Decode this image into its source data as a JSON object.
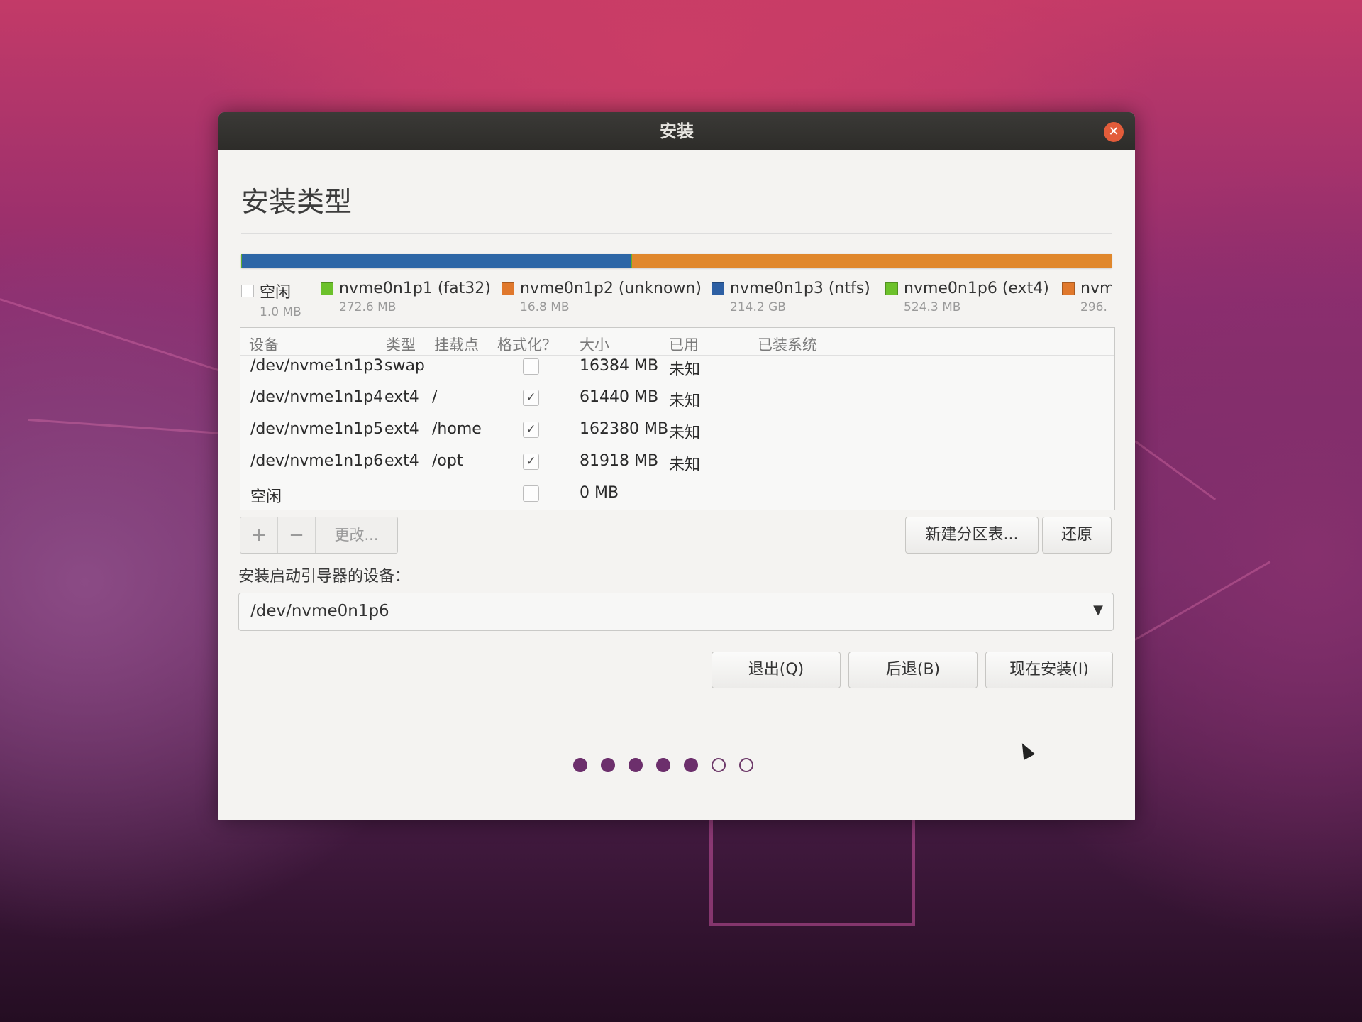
{
  "window": {
    "title": "安装",
    "close_icon": "close-icon"
  },
  "page": {
    "heading": "安装类型"
  },
  "partition_bar": {
    "segments": [
      {
        "name": "空闲",
        "color": "#ffffff",
        "fraction": 0.0002
      },
      {
        "name": "nvme0n1p1",
        "color": "#5fae2c",
        "fraction": 0.0006
      },
      {
        "name": "nvme0n1p2",
        "color": "#e0782c",
        "fraction": 0.0001
      },
      {
        "name": "nvme0n1p3",
        "color": "#2d66a6",
        "fraction": 0.447
      },
      {
        "name": "nvme0n1p6",
        "color": "#5fae2c",
        "fraction": 0.001
      },
      {
        "name": "nvm",
        "color": "#e0872c",
        "fraction": 0.5511
      }
    ]
  },
  "legend": [
    {
      "name": "空闲",
      "size": "1.0 MB",
      "color": "#ffffff"
    },
    {
      "name": "nvme0n1p1 (fat32)",
      "size": "272.6 MB",
      "color": "#6cc12b"
    },
    {
      "name": "nvme0n1p2 (unknown)",
      "size": "16.8 MB",
      "color": "#e0782c"
    },
    {
      "name": "nvme0n1p3 (ntfs)",
      "size": "214.2 GB",
      "color": "#2d5fa3"
    },
    {
      "name": "nvme0n1p6 (ext4)",
      "size": "524.3 MB",
      "color": "#6cc12b"
    },
    {
      "name": "nvm",
      "size": "296.",
      "color": "#e0782c"
    }
  ],
  "table": {
    "headers": {
      "device": "设备",
      "type": "类型",
      "mount": "挂载点",
      "format": "格式化？",
      "size": "大小",
      "used": "已用",
      "system": "已装系统"
    },
    "rows": [
      {
        "device": "/dev/nvme1n1p3",
        "type": "swap",
        "mount": "",
        "format": false,
        "size": "16384 MB",
        "used": "未知"
      },
      {
        "device": "/dev/nvme1n1p4",
        "type": "ext4",
        "mount": "/",
        "format": true,
        "size": "61440 MB",
        "used": "未知"
      },
      {
        "device": "/dev/nvme1n1p5",
        "type": "ext4",
        "mount": "/home",
        "format": true,
        "size": "162380 MB",
        "used": "未知"
      },
      {
        "device": "/dev/nvme1n1p6",
        "type": "ext4",
        "mount": "/opt",
        "format": true,
        "size": "81918 MB",
        "used": "未知"
      },
      {
        "device": "空闲",
        "type": "",
        "mount": "",
        "format": false,
        "size": "0 MB",
        "used": ""
      }
    ],
    "check_glyph": "✓"
  },
  "toolbar": {
    "add": "+",
    "remove": "−",
    "change": "更改..."
  },
  "table_actions": {
    "new_table": "新建分区表...",
    "revert": "还原"
  },
  "bootloader": {
    "label": "安装启动引导器的设备：",
    "value": "/dev/nvme0n1p6",
    "arrow": "▼"
  },
  "actions": {
    "quit": "退出(Q)",
    "back": "后退(B)",
    "install": "现在安装(I)"
  },
  "progress": {
    "total_steps": 7,
    "completed_steps": 5
  },
  "colors": {
    "accent": "#6c2f6c",
    "close": "#e35c3a"
  }
}
